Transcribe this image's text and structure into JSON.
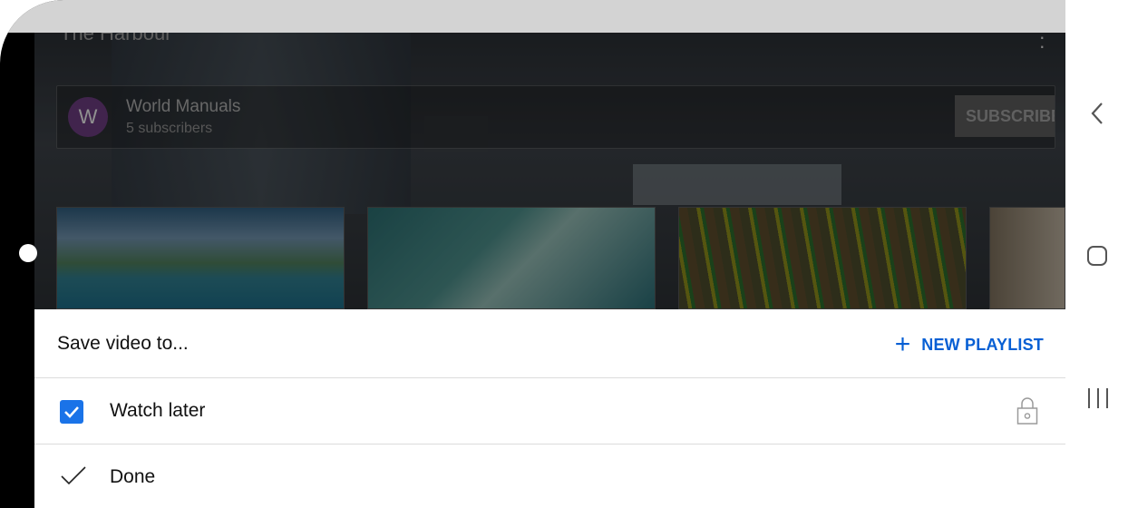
{
  "video": {
    "title": "The Harbour",
    "channel_initial": "W",
    "channel_name": "World Manuals",
    "subscribers": "5 subscribers",
    "subscribe_label": "SUBSCRIBE"
  },
  "sheet": {
    "title": "Save video to...",
    "new_playlist_label": "NEW PLAYLIST",
    "playlists": [
      {
        "label": "Watch later",
        "checked": true,
        "private": true
      }
    ],
    "done_label": "Done"
  },
  "colors": {
    "accent": "#065fd4",
    "checkbox": "#1a73e8",
    "avatar": "#6a3b7c"
  },
  "icons": [
    "plus-icon",
    "checkbox-checked-icon",
    "lock-icon",
    "check-icon",
    "more-vert-icon",
    "back-icon",
    "home-icon",
    "recents-icon"
  ]
}
